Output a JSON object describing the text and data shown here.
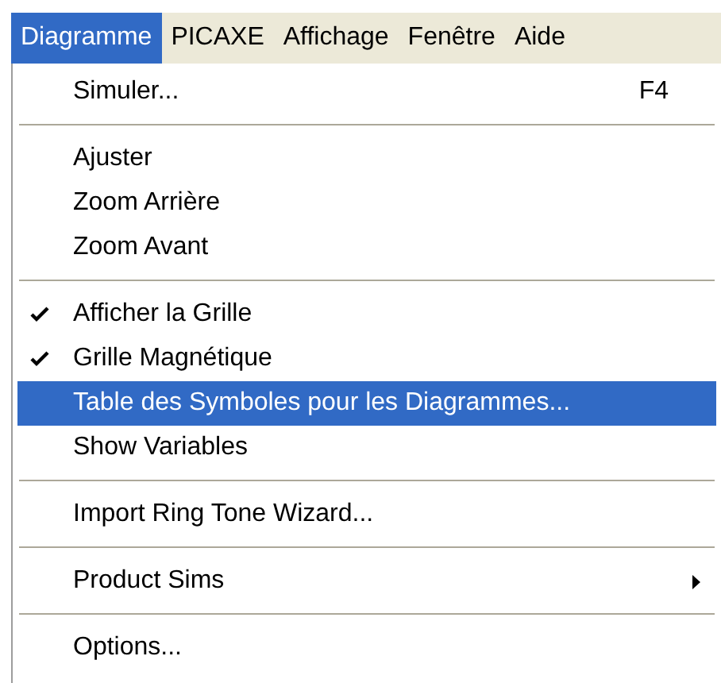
{
  "menu_bar": [
    {
      "label": "Diagramme",
      "selected": true
    },
    {
      "label": "PICAXE",
      "selected": false
    },
    {
      "label": "Affichage",
      "selected": false
    },
    {
      "label": "Fenêtre",
      "selected": false
    },
    {
      "label": "Aide",
      "selected": false
    }
  ],
  "menu": [
    {
      "kind": "item",
      "label": "Simuler...",
      "shortcut": "F4",
      "checked": false,
      "selected": false,
      "submenu": false
    },
    {
      "kind": "separator"
    },
    {
      "kind": "item",
      "label": "Ajuster",
      "checked": false,
      "selected": false,
      "submenu": false
    },
    {
      "kind": "item",
      "label": "Zoom Arrière",
      "checked": false,
      "selected": false,
      "submenu": false
    },
    {
      "kind": "item",
      "label": "Zoom Avant",
      "checked": false,
      "selected": false,
      "submenu": false
    },
    {
      "kind": "separator"
    },
    {
      "kind": "item",
      "label": "Afficher la Grille",
      "checked": true,
      "selected": false,
      "submenu": false
    },
    {
      "kind": "item",
      "label": "Grille Magnétique",
      "checked": true,
      "selected": false,
      "submenu": false
    },
    {
      "kind": "item",
      "label": "Table des Symboles pour les Diagrammes...",
      "checked": false,
      "selected": true,
      "submenu": false
    },
    {
      "kind": "item",
      "label": "Show Variables",
      "checked": false,
      "selected": false,
      "submenu": false
    },
    {
      "kind": "separator"
    },
    {
      "kind": "item",
      "label": "Import Ring Tone Wizard...",
      "checked": false,
      "selected": false,
      "submenu": false
    },
    {
      "kind": "separator"
    },
    {
      "kind": "item",
      "label": "Product Sims",
      "checked": false,
      "selected": false,
      "submenu": true
    },
    {
      "kind": "separator"
    },
    {
      "kind": "item",
      "label": "Options...",
      "checked": false,
      "selected": false,
      "submenu": false
    }
  ]
}
